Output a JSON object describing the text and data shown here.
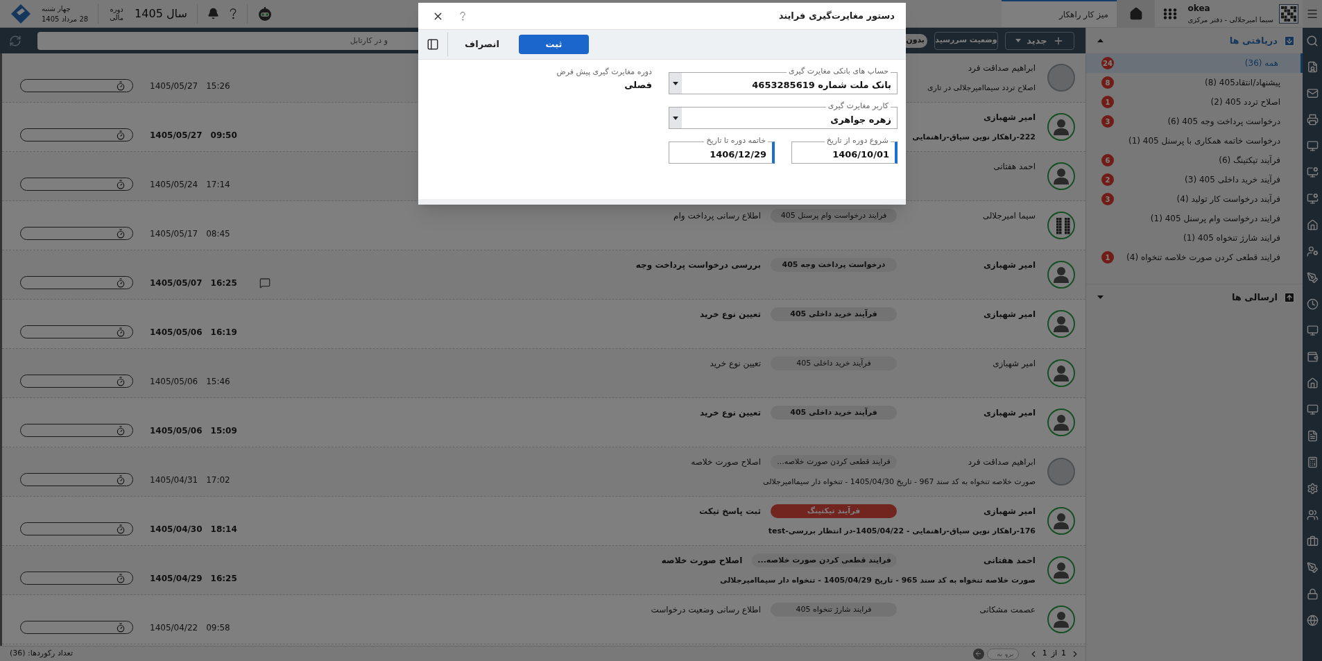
{
  "top_bar": {
    "user_name": "okea",
    "user_office": "سیما امیرجلالی - دفتر مرکزی",
    "tab": "میز کار راهکار",
    "fiscal_label": "دوره مالی",
    "fiscal_year": "سال 1405",
    "weekday": "چهار شنبه",
    "date": "28 مرداد 1405"
  },
  "toolbar": {
    "new_button": "جدید",
    "due_status_button": "وضعیت سررسید",
    "filter_chip": "بدون",
    "search_placeholder": "و در کارتابل"
  },
  "sidebar": {
    "sections": [
      {
        "title": "دریافتی ها",
        "kind": "inbox",
        "expanded": true,
        "items": [
          {
            "label": "همه (36)",
            "badge": "24",
            "selected": true
          },
          {
            "label": "پیشنهاد/انتقاد405 (8)",
            "badge": "8",
            "selected": false
          },
          {
            "label": "اصلاح تردد 405 (2)",
            "badge": "1",
            "selected": false
          },
          {
            "label": "درخواست پرداخت وجه 405 (6)",
            "badge": "3",
            "selected": false
          },
          {
            "label": "درخواست خاتمه همکاری با پرسنل 405 (1)",
            "selected": false
          },
          {
            "label": "فرآیند تیکتینگ (6)",
            "badge": "6",
            "selected": false
          },
          {
            "label": "فرآیند خرید داخلی 405 (3)",
            "badge": "2",
            "selected": false
          },
          {
            "label": "فرآیند درخواست کار تولید (4)",
            "badge": "3",
            "selected": false
          },
          {
            "label": "فرایند درخواست وام پرسنل 405 (1)",
            "selected": false
          },
          {
            "label": "فرایند شارژ تنخواه 405 (1)",
            "selected": false
          },
          {
            "label": "فرایند قطعی کردن صورت خلاصه تنخواه (4)",
            "badge": "1",
            "selected": false
          }
        ]
      },
      {
        "title": "ارسالی ها",
        "kind": "outbox",
        "expanded": false
      }
    ]
  },
  "rows": [
    {
      "kind": "photo",
      "sender": "ابراهیم صداقت فرد",
      "description": "اصلاح تردد سیماامیرجلالی در تاری",
      "time": "15:26",
      "date": "1405/05/27",
      "unread": false,
      "has_comment": false
    },
    {
      "kind": "person",
      "sender": "امیر شهبازی",
      "description": "222-راهکار نوین سیاق-راهنمایی",
      "time": "09:50",
      "date": "1405/05/27",
      "unread": true,
      "has_comment": false
    },
    {
      "kind": "person",
      "sender": "احمد هفتانی",
      "time": "17:14",
      "date": "1405/05/24",
      "unread": false,
      "has_comment": false
    },
    {
      "kind": "qr",
      "sender": "سیما امیرجلالی",
      "process": "فرایند درخواست وام پرسنل 405",
      "highlighted": false,
      "step": "اطلاع رسانی پرداخت وام",
      "time": "08:45",
      "date": "1405/05/17",
      "unread": false,
      "has_comment": false
    },
    {
      "kind": "person",
      "sender": "امیر شهبازی",
      "process": "درخواست پرداخت وجه 405",
      "highlighted": false,
      "step": "بررسی درخواست پرداخت وجه",
      "time": "16:25",
      "date": "1405/05/07",
      "unread": true,
      "has_comment": true
    },
    {
      "kind": "person",
      "sender": "امیر شهبازی",
      "process": "فرآیند خرید داخلی 405",
      "highlighted": false,
      "step": "تعیین نوع خرید",
      "time": "16:19",
      "date": "1405/05/06",
      "unread": true,
      "has_comment": false
    },
    {
      "kind": "person",
      "sender": "امیر شهبازی",
      "process": "فرآیند خرید داخلی 405",
      "highlighted": false,
      "step": "تعیین نوع خرید",
      "time": "15:46",
      "date": "1405/05/06",
      "unread": false,
      "has_comment": false
    },
    {
      "kind": "person",
      "sender": "امیر شهبازی",
      "process": "فرآیند خرید داخلی 405",
      "highlighted": false,
      "step": "تعیین نوع خرید",
      "time": "15:09",
      "date": "1405/05/06",
      "unread": true,
      "has_comment": false
    },
    {
      "kind": "photo",
      "sender": "ابراهیم صداقت فرد",
      "process": "فرایند قطعی کردن صورت خلاصه...",
      "highlighted": false,
      "step": "اصلاح صورت خلاصه",
      "description": "صورت خلاصه تنخواه به کد سند 967 - تاریخ 1405/04/30 - تنخواه دار سیماامیرجلالی",
      "time": "17:02",
      "date": "1405/04/31",
      "unread": false,
      "has_comment": false
    },
    {
      "kind": "person",
      "sender": "امیر شهبازی",
      "process": "فرآیند تیکتینگ",
      "highlighted": true,
      "step": "ثبت پاسخ تیکت",
      "description": "176-راهکار نوین سیاق-راهنمایی - 1405/04/22-در انتظار بررسی-test",
      "time": "18:14",
      "date": "1405/04/30",
      "unread": true,
      "has_comment": false
    },
    {
      "kind": "person",
      "sender": "احمد هفتانی",
      "process": "فرایند قطعی کردن صورت خلاصه...",
      "highlighted": false,
      "step": "اصلاح صورت خلاصه",
      "description": "صورت خلاصه تنخواه به کد سند 965 - تاریخ 1405/04/29 - تنخواه دار سیماامیرجلالی",
      "time": "16:25",
      "date": "1405/04/29",
      "unread": true,
      "has_comment": false
    },
    {
      "kind": "person",
      "sender": "عصمت مشکانی",
      "process": "فرایند شارژ تنخواه 405",
      "highlighted": false,
      "step": "اطلاع رسانی وضعیت درخواست",
      "time": "09:58",
      "date": "1405/04/22",
      "unread": false,
      "has_comment": false
    }
  ],
  "footer": {
    "record_count": "تعداد رکوردها: (36)",
    "page": "1",
    "of": "از",
    "total": "1",
    "goto_placeholder": "برو به"
  },
  "dialog": {
    "title": "دستور مغایرت‌گیری فرایند",
    "buttons": [
      {
        "label": "ثبت",
        "kind": "primary"
      },
      {
        "label": "انصراف",
        "kind": "secondary"
      }
    ],
    "fields": [
      {
        "kind": "select",
        "label": "حساب های بانکی مغایرت گیری",
        "value": "بانک ملت شماره 4653285619"
      },
      {
        "kind": "select",
        "label": "کاربر مغایرت گیری",
        "value": "زهره جواهری"
      },
      {
        "kind": "date",
        "label": "شروع دوره از تاریخ",
        "value": "1406/10/01",
        "required": true
      },
      {
        "kind": "date",
        "label": "خاتمه دوره تا تاریخ",
        "value": "1406/12/29",
        "required": true
      }
    ],
    "default_period": {
      "label": "دوره مغایرت گیری پیش فرض",
      "value": "فصلی"
    }
  }
}
